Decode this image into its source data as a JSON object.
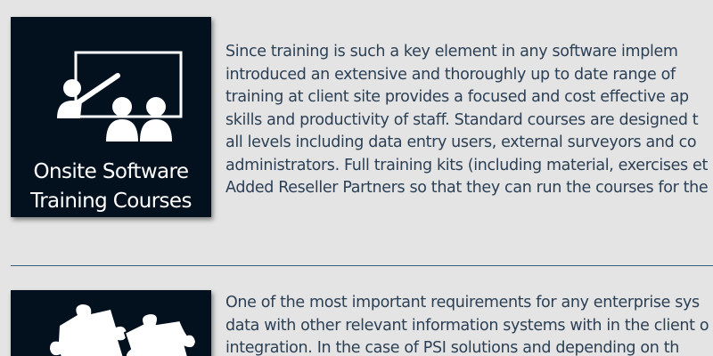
{
  "section1": {
    "tile": {
      "caption_line1": "Onsite Software",
      "caption_line2": "Training Courses",
      "icon": "training-presentation-icon"
    },
    "lines": [
      "Since training is such a key element in any software implem",
      "introduced an extensive and thoroughly up to date range of",
      "training at client site provides a focused and cost effective ap",
      "skills and productivity of staff. Standard courses are designed t",
      "all levels including data entry users, external surveyors and co",
      "administrators. Full training kits (including material, exercises et",
      "Added Reseller Partners so that they can run the courses for the"
    ]
  },
  "section2": {
    "tile": {
      "icon": "puzzle-pieces-icon"
    },
    "lines": [
      "One of the most important requirements for any enterprise sys",
      "data with other relevant information systems with in the client o",
      "integration. In the case of PSI solutions and depending on th"
    ]
  },
  "colors": {
    "background": "#e4e4e4",
    "tile_background": "#03111f",
    "body_text": "#2b3f55",
    "divider": "#3c5b7a"
  }
}
